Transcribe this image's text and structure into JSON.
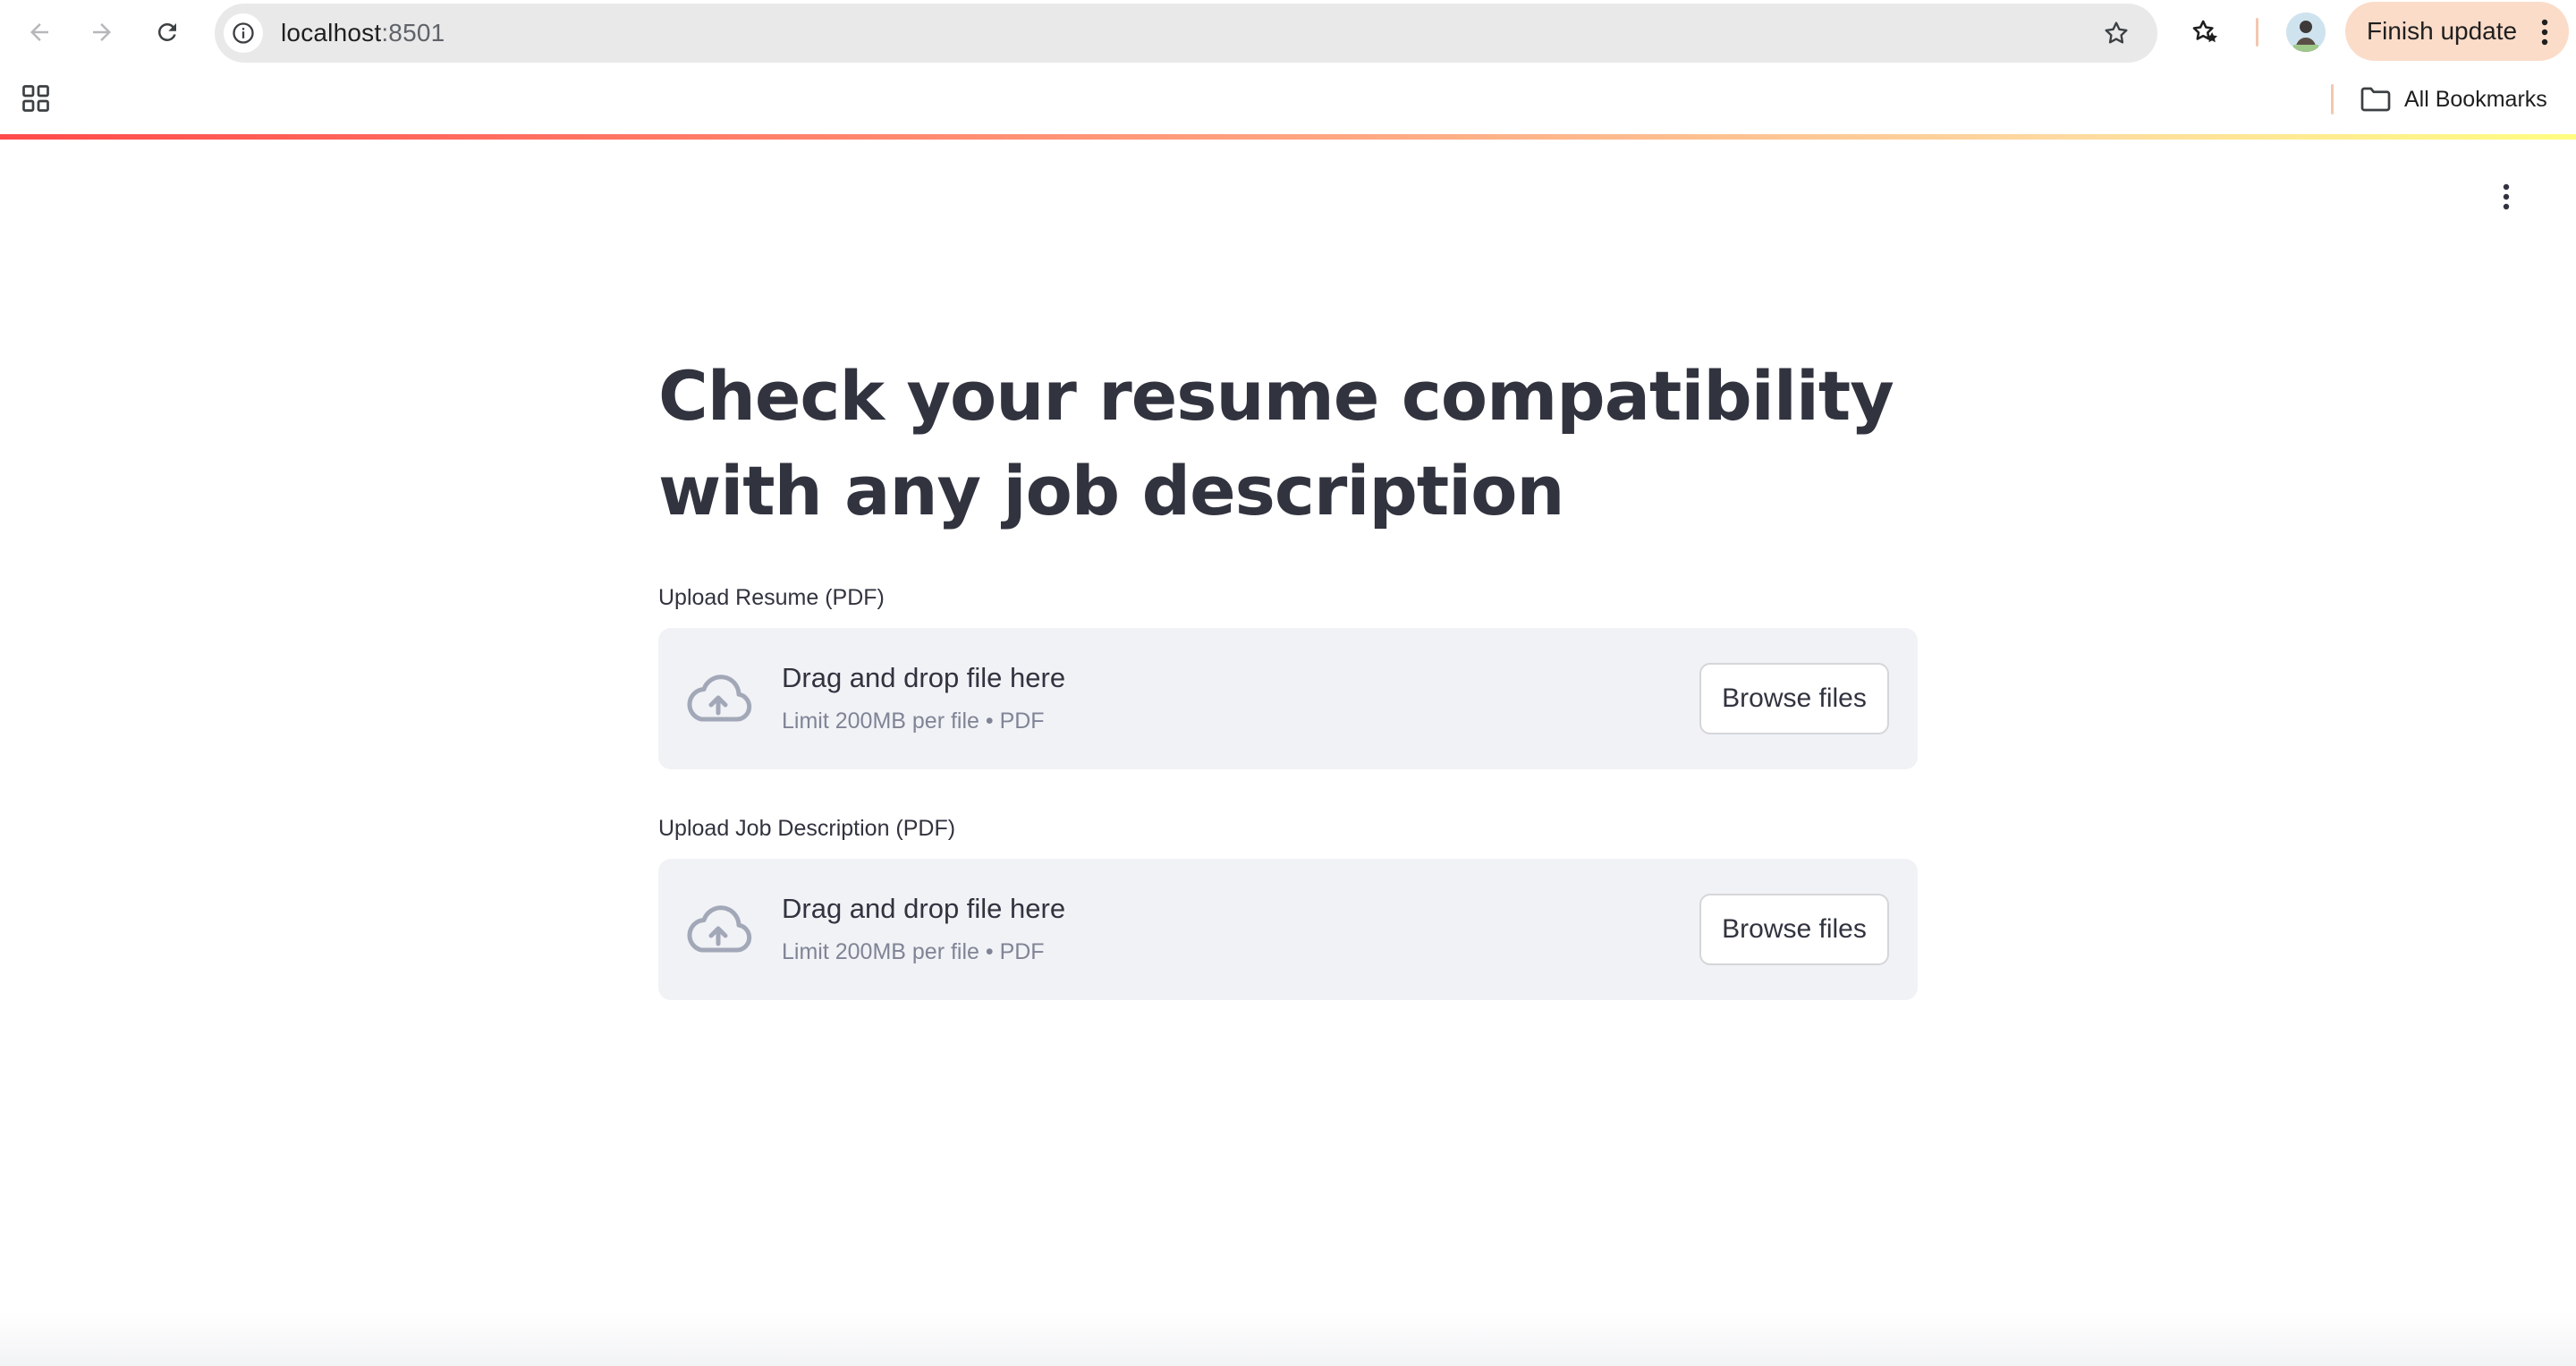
{
  "browser": {
    "url_host": "localhost",
    "url_port": ":8501",
    "finish_update_label": "Finish update",
    "bookmarks_label": "All Bookmarks"
  },
  "page": {
    "title": "Check your resume compatibility with any job description",
    "uploaders": [
      {
        "label": "Upload Resume (PDF)",
        "drop_text": "Drag and drop file here",
        "limit_text": "Limit 200MB per file • PDF",
        "button_label": "Browse files"
      },
      {
        "label": "Upload Job Description (PDF)",
        "drop_text": "Drag and drop file here",
        "limit_text": "Limit 200MB per file • PDF",
        "button_label": "Browse files"
      }
    ]
  },
  "icons": [
    "back-icon",
    "forward-icon",
    "reload-icon",
    "site-info-icon",
    "star-icon",
    "bookmark-manager-icon",
    "kebab-icon",
    "apps-icon",
    "folder-icon",
    "cloud-upload-icon",
    "more-vert-icon"
  ],
  "colors": {
    "accent_gradient_start": "#ff4b4b",
    "accent_gradient_end": "#fffd80",
    "dropzone_bg": "#f0f2f6",
    "text_primary": "#31333f",
    "text_secondary": "#808495",
    "update_chip": "#fbdcc9"
  }
}
